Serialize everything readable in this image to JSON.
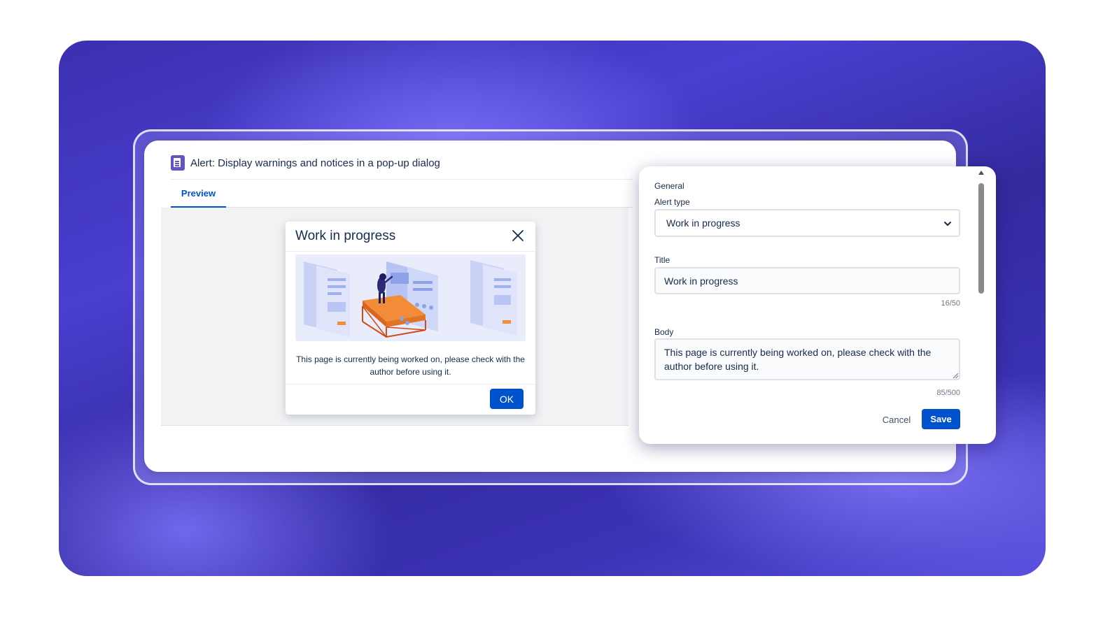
{
  "window": {
    "title": "Alert: Display warnings and notices in a pop-up dialog",
    "title_icon": "document-icon"
  },
  "tabs": [
    {
      "label": "Preview",
      "active": true
    }
  ],
  "alert_dialog": {
    "title": "Work in progress",
    "body": "This page is currently being worked on, please check with the author before using it.",
    "ok_label": "OK",
    "close_icon": "close-icon",
    "illustration": "person-building-pages-illustration"
  },
  "settings": {
    "section_label": "General",
    "alert_type": {
      "label": "Alert type",
      "selected": "Work in progress"
    },
    "title_field": {
      "label": "Title",
      "value": "Work in progress",
      "counter": "16/50"
    },
    "body_field": {
      "label": "Body",
      "value": "This page is currently being worked on, please check with the author before using it.",
      "counter": "85/500"
    },
    "cancel_label": "Cancel",
    "save_label": "Save"
  },
  "colors": {
    "primary": "#0052cc",
    "accent_purple": "#6554c0",
    "background_gradient": "#3b30b0",
    "text": "#172b4d"
  }
}
